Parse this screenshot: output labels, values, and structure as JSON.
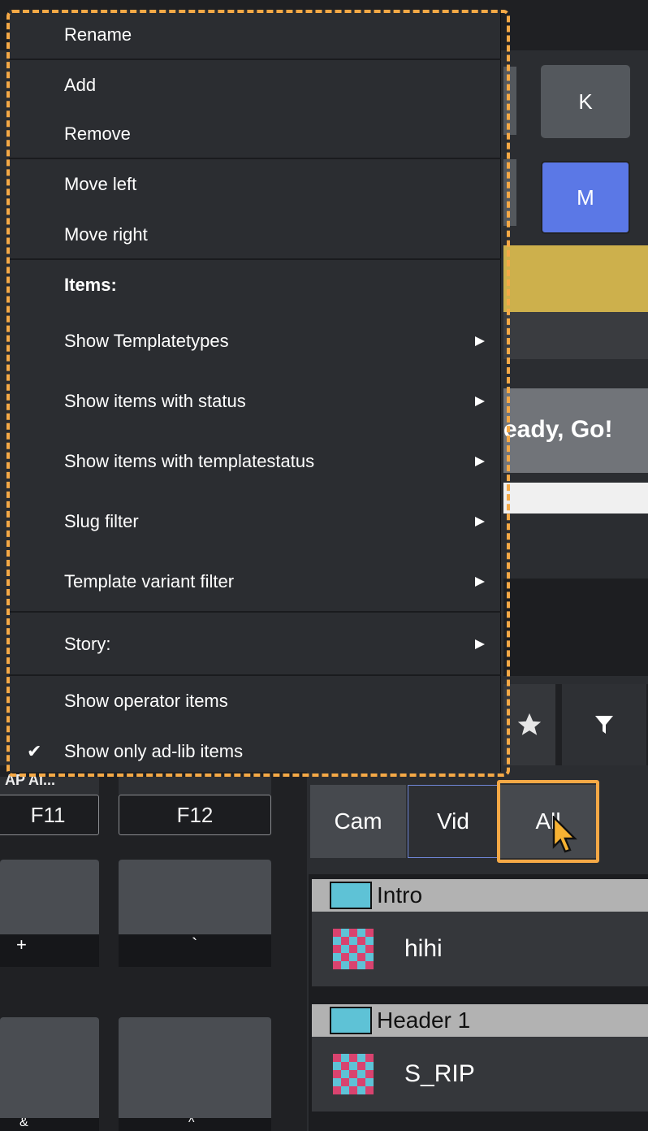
{
  "menu": {
    "rename": "Rename",
    "add": "Add",
    "remove": "Remove",
    "move_left": "Move left",
    "move_right": "Move right",
    "items_header": "Items:",
    "show_templatetypes": "Show Templatetypes",
    "show_items_with_status": "Show items with status",
    "show_items_with_templatestatus": "Show items with templatestatus",
    "slug_filter": "Slug filter",
    "template_variant_filter": "Template variant filter",
    "story": "Story:",
    "show_operator_items": "Show operator items",
    "show_only_adlib_items": "Show only ad-lib items",
    "check_mark": "✔"
  },
  "keys": {
    "k": "K",
    "m": "M",
    "f11": "F11",
    "f12": "F12",
    "truncated_label": "AP Ai..."
  },
  "story_title_fragment": "eady, Go!",
  "cells": {
    "plus": "+",
    "backtick": "`",
    "amp": "&",
    "caret": "^"
  },
  "filters": {
    "cam": "Cam",
    "vid": "Vid",
    "all": "All"
  },
  "groups": [
    {
      "header": "Intro",
      "item": "hihi"
    },
    {
      "header": "Header 1",
      "item": "S_RIP"
    }
  ],
  "colors": {
    "accent_orange": "#f5a946",
    "key_blue": "#5b78e6",
    "yellow_bar": "#cdb04c",
    "swatch_cyan": "#5ec2d6",
    "checker_pink": "#d9436f"
  }
}
